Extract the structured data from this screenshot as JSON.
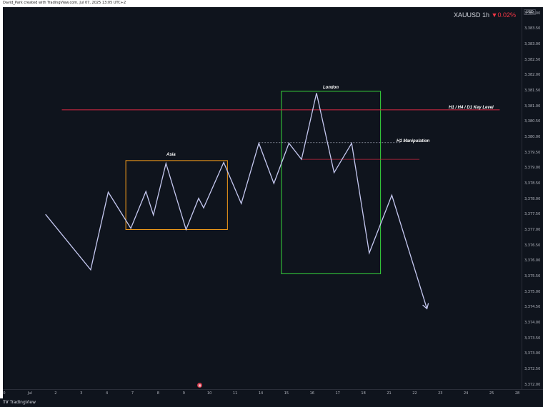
{
  "header": {
    "caption": "David_Park created with TradingView.com, Jul 07, 2025 13:05 UTC+2"
  },
  "legend": {
    "symbol": "XAUUSD",
    "interval": "1h",
    "change_arrow": "▼",
    "change": "0.02%",
    "down_color": "#f23645"
  },
  "price_axis": {
    "currency": "USD",
    "ticks": [
      "3,384.00",
      "3,383.50",
      "3,383.00",
      "3,382.50",
      "3,382.00",
      "3,381.50",
      "3,381.00",
      "3,380.50",
      "3,380.00",
      "3,379.50",
      "3,379.00",
      "3,378.50",
      "3,378.00",
      "3,377.50",
      "3,377.00",
      "3,376.50",
      "3,376.00",
      "3,375.50",
      "3,375.00",
      "3,374.50",
      "3,374.00",
      "3,373.50",
      "3,373.00",
      "3,372.50",
      "3,372.00"
    ]
  },
  "time_axis": {
    "ticks": [
      {
        "label": "0",
        "x": 0
      },
      {
        "label": "Jul",
        "x": 1
      },
      {
        "label": "2",
        "x": 2
      },
      {
        "label": "3",
        "x": 3
      },
      {
        "label": "4",
        "x": 4
      },
      {
        "label": "7",
        "x": 5
      },
      {
        "label": "8",
        "x": 6
      },
      {
        "label": "9",
        "x": 7
      },
      {
        "label": "10",
        "x": 8
      },
      {
        "label": "11",
        "x": 9
      },
      {
        "label": "14",
        "x": 10
      },
      {
        "label": "15",
        "x": 11
      },
      {
        "label": "16",
        "x": 12
      },
      {
        "label": "17",
        "x": 13
      },
      {
        "label": "18",
        "x": 14
      },
      {
        "label": "21",
        "x": 15
      },
      {
        "label": "22",
        "x": 16
      },
      {
        "label": "23",
        "x": 17
      },
      {
        "label": "24",
        "x": 18
      },
      {
        "label": "25",
        "x": 19
      },
      {
        "label": "28",
        "x": 20
      }
    ]
  },
  "chart_data": {
    "type": "line",
    "ylim": [
      3371.85,
      3384.2
    ],
    "xlim": [
      0,
      20.67
    ],
    "line_color": "#c5c8f0",
    "series": [
      {
        "points": [
          [
            1.7,
            3377.5
          ],
          [
            3.5,
            3375.71
          ],
          [
            4.2,
            3378.22
          ],
          [
            5.1,
            3377.05
          ],
          [
            5.7,
            3378.24
          ],
          [
            6.0,
            3377.48
          ],
          [
            6.5,
            3379.15
          ],
          [
            7.3,
            3377.01
          ],
          [
            7.8,
            3378.02
          ],
          [
            8.0,
            3377.71
          ],
          [
            8.8,
            3379.18
          ],
          [
            9.5,
            3377.85
          ],
          [
            10.2,
            3379.8
          ],
          [
            10.8,
            3378.5
          ],
          [
            11.4,
            3379.8
          ],
          [
            11.9,
            3379.28
          ],
          [
            12.5,
            3381.42
          ],
          [
            13.2,
            3378.85
          ],
          [
            13.9,
            3379.8
          ],
          [
            14.6,
            3376.25
          ],
          [
            15.5,
            3378.12
          ],
          [
            16.9,
            3374.45
          ]
        ]
      }
    ],
    "end_arrow": true,
    "key_level": {
      "label": "H1 / H4 / D1 Key Level",
      "y": 3380.88,
      "x_start": 2.35,
      "x_end": 19.8,
      "color": "#c1263f"
    },
    "manipulation": {
      "label": "H1 Manipulation",
      "dashed_y": 3379.82,
      "dashed_x": [
        10.2,
        15.85
      ],
      "red_y": 3379.28,
      "red_x": [
        11.9,
        16.6
      ],
      "color": "#c1263f"
    },
    "boxes": [
      {
        "label": "Asia",
        "x0": 4.9,
        "x1": 8.95,
        "y0": 3379.24,
        "y1": 3377.01,
        "color": "#f59c1a"
      },
      {
        "label": "London",
        "x0": 11.1,
        "x1": 15.05,
        "y0": 3381.48,
        "y1": 3375.58,
        "color": "#37d63c"
      }
    ]
  }
}
